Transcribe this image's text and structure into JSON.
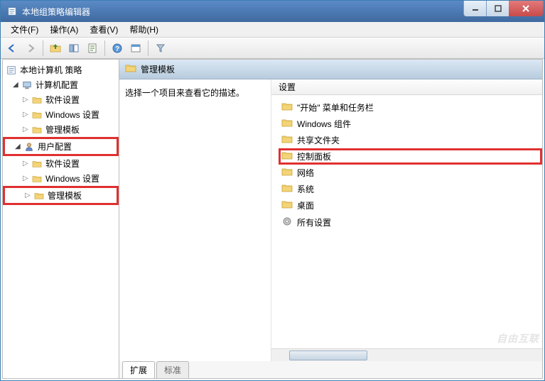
{
  "window": {
    "title": "本地组策略编辑器"
  },
  "menus": {
    "file": "文件(F)",
    "action": "操作(A)",
    "view": "查看(V)",
    "help": "帮助(H)"
  },
  "tree": {
    "root": "本地计算机 策略",
    "computer_config": "计算机配置",
    "comp_software": "软件设置",
    "comp_windows": "Windows 设置",
    "comp_admin": "管理模板",
    "user_config": "用户配置",
    "user_software": "软件设置",
    "user_windows": "Windows 设置",
    "user_admin": "管理模板"
  },
  "header_path": "管理模板",
  "desc_text": "选择一个项目来查看它的描述。",
  "list_header": "设置",
  "items": {
    "start_menu": "\"开始\" 菜单和任务栏",
    "win_components": "Windows 组件",
    "shared_folders": "共享文件夹",
    "control_panel": "控制面板",
    "network": "网络",
    "system": "系统",
    "desktop": "桌面",
    "all_settings": "所有设置"
  },
  "tabs": {
    "extended": "扩展",
    "standard": "标准"
  },
  "watermark": "自由互联"
}
